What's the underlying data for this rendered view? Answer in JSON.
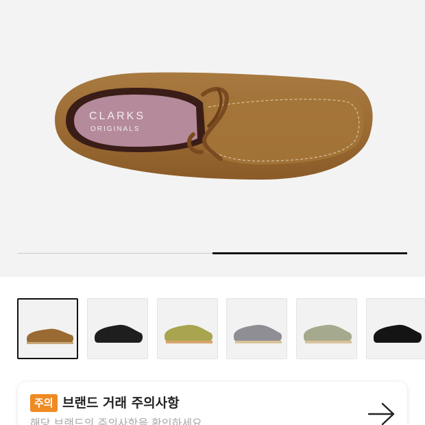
{
  "product_image": {
    "brand_line_1": "CLARKS",
    "brand_line_2": "ORIGINALS"
  },
  "gallery": {
    "current_slide_fraction": 0.5,
    "thumbnails": [
      {
        "color_name": "cola-suede-icon",
        "shade": "#9a6a33"
      },
      {
        "color_name": "black-leather-icon",
        "shade": "#1e1e1e"
      },
      {
        "color_name": "olive-suede-icon",
        "shade": "#a8a44f"
      },
      {
        "color_name": "grey-suede-icon",
        "shade": "#8e8e94"
      },
      {
        "color_name": "sage-suede-icon",
        "shade": "#a5a98d"
      },
      {
        "color_name": "black-suede-icon",
        "shade": "#141414"
      }
    ]
  },
  "notice": {
    "badge": "주의",
    "title": "브랜드 거래 주의사항",
    "subtitle": "해당 브랜드의 주의사항을 확인하세요"
  },
  "colors": {
    "accent": "#f08a22",
    "hero_background": "#f3f3f3"
  }
}
